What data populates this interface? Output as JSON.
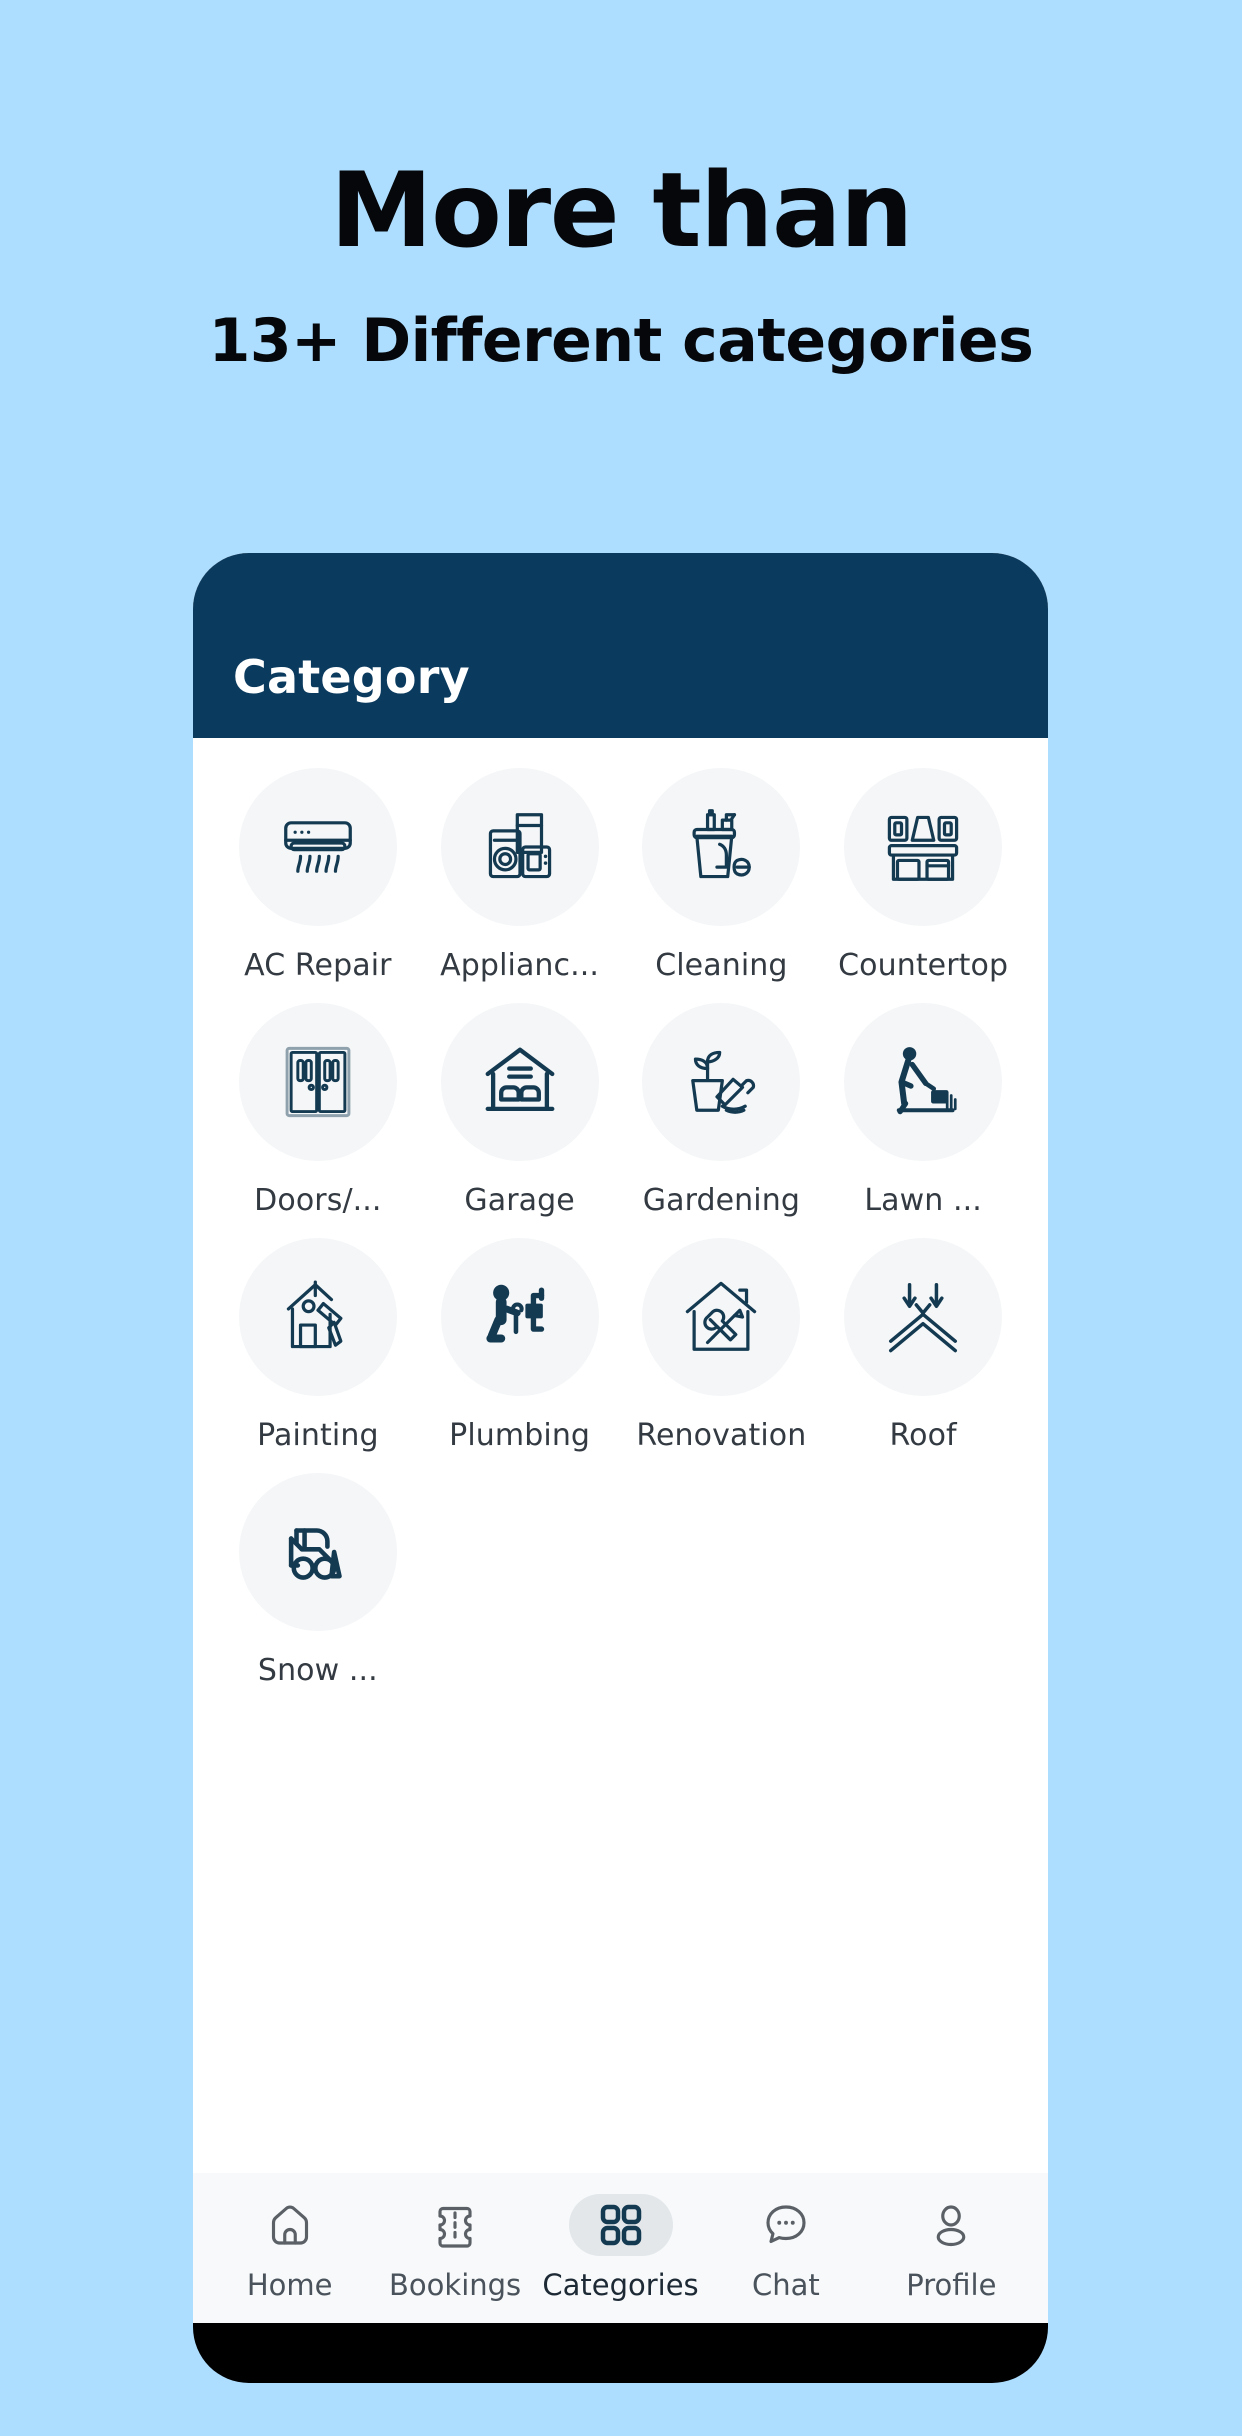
{
  "promo": {
    "title": "More than",
    "subtitle": "13+ Different categories"
  },
  "colors": {
    "background": "#ADDDFF",
    "header_navy": "#0A3A5E",
    "circle_gray": "#F4F6F7",
    "icon_navy": "#143A52",
    "nav_bar": "#F7F9FA",
    "nav_active_pill": "#E3E7EA",
    "label_text": "#333A42"
  },
  "app": {
    "header_title": "Category",
    "categories": [
      {
        "label": "AC Repair",
        "icon": "air-conditioner-icon"
      },
      {
        "label": "Applianc...",
        "icon": "appliances-icon"
      },
      {
        "label": "Cleaning",
        "icon": "cleaning-supplies-icon"
      },
      {
        "label": "Countertop",
        "icon": "kitchen-countertop-icon"
      },
      {
        "label": "Doors/...",
        "icon": "double-doors-icon"
      },
      {
        "label": "Garage",
        "icon": "garage-icon"
      },
      {
        "label": "Gardening",
        "icon": "potted-plant-shovel-icon"
      },
      {
        "label": "Lawn ...",
        "icon": "lawn-mower-person-icon"
      },
      {
        "label": "Painting",
        "icon": "house-paint-roller-icon"
      },
      {
        "label": "Plumbing",
        "icon": "plumber-person-icon"
      },
      {
        "label": "Renovation",
        "icon": "house-tools-icon"
      },
      {
        "label": "Roof",
        "icon": "roof-chevron-icon"
      },
      {
        "label": "Snow ...",
        "icon": "snow-plow-loader-icon"
      }
    ],
    "bottom_nav": [
      {
        "label": "Home",
        "icon": "home-icon",
        "active": false
      },
      {
        "label": "Bookings",
        "icon": "ticket-icon",
        "active": false
      },
      {
        "label": "Categories",
        "icon": "grid-icon",
        "active": true
      },
      {
        "label": "Chat",
        "icon": "chat-bubble-icon",
        "active": false
      },
      {
        "label": "Profile",
        "icon": "person-icon",
        "active": false
      }
    ]
  }
}
